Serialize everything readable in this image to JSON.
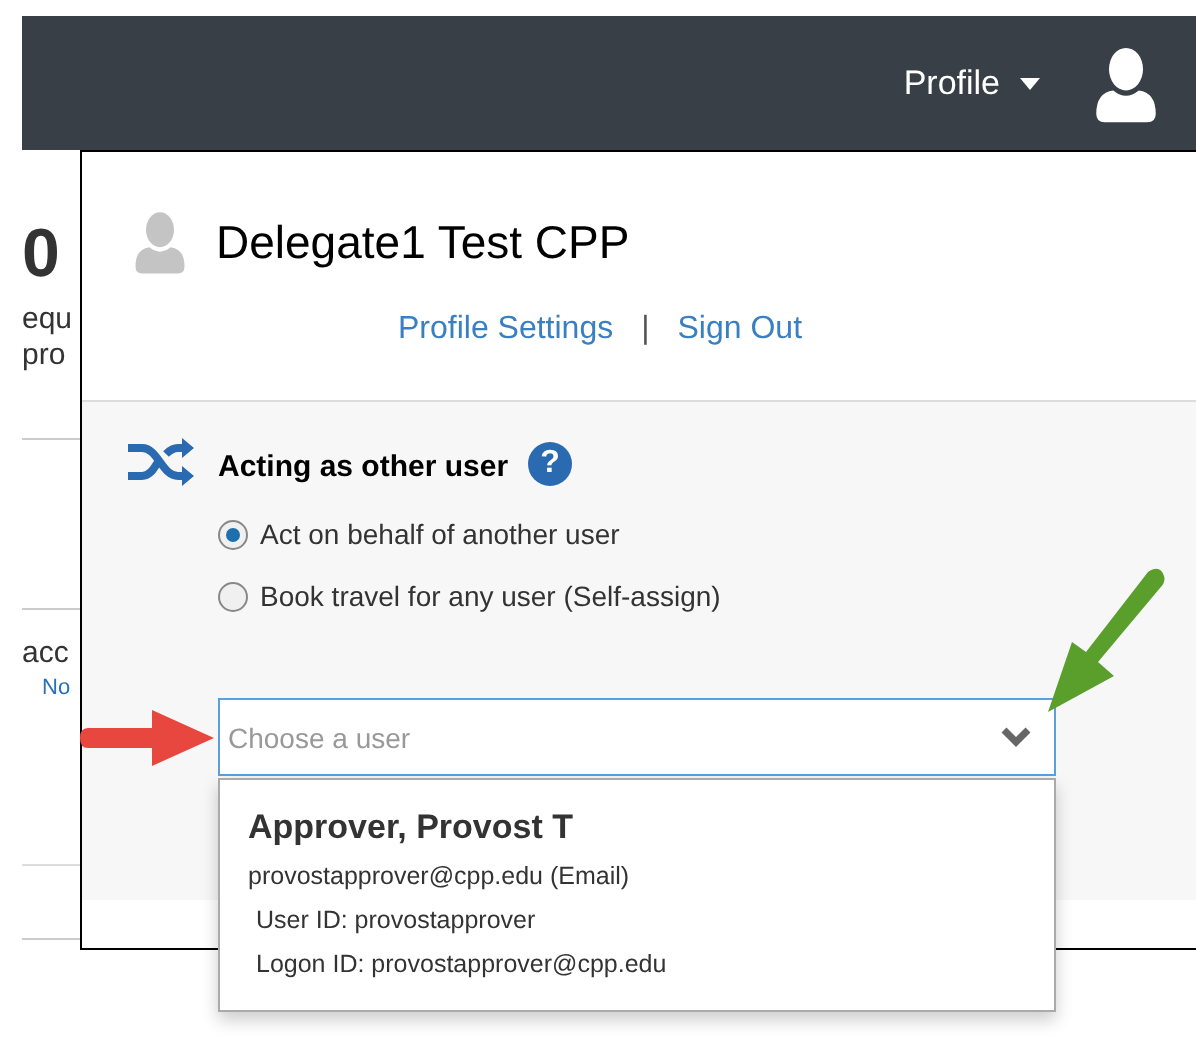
{
  "top_bar": {
    "profile_menu": "Profile"
  },
  "background_page": {
    "fragments": [
      {
        "text": "0",
        "kind": "heading"
      },
      {
        "text": "equ",
        "kind": "text"
      },
      {
        "text": "pro",
        "kind": "text"
      },
      {
        "text": "acc",
        "kind": "text"
      },
      {
        "text": "No",
        "kind": "link"
      }
    ]
  },
  "profile_panel": {
    "user_name": "Delegate1 Test CPP",
    "links": [
      "Profile Settings",
      "Sign Out"
    ],
    "separator": "|",
    "acting": {
      "title": "Acting as other user",
      "help": "?",
      "options": [
        {
          "label": "Act on behalf of another user",
          "selected": true
        },
        {
          "label": "Book travel for any user (Self-assign)",
          "selected": false
        }
      ]
    },
    "user_field": {
      "placeholder": "Choose a user"
    }
  },
  "results": [
    {
      "name": "Approver, Provost T",
      "email": "provostapprover@cpp.edu (Email)",
      "user_id": "User ID: provostapprover",
      "logon_id": "Logon ID: provostapprover@cpp.edu"
    }
  ]
}
